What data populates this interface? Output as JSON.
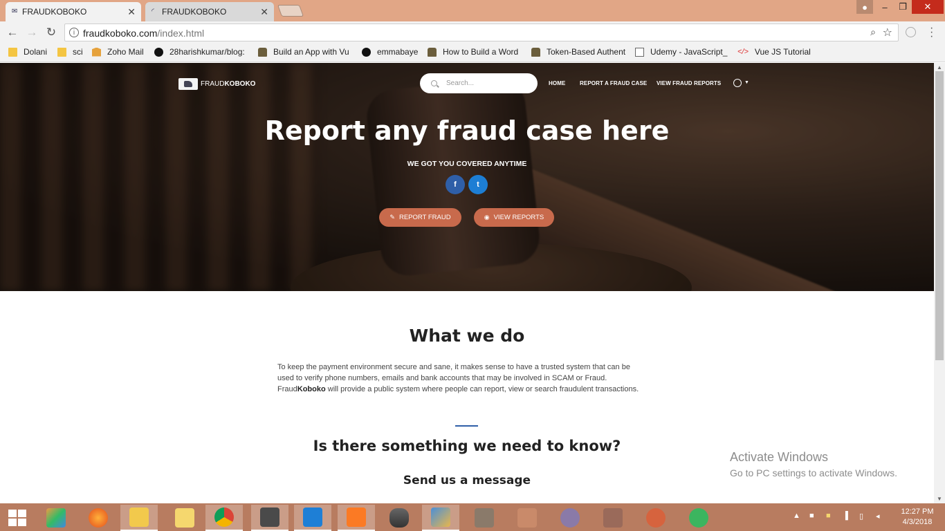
{
  "browser": {
    "tabs": [
      {
        "label": "FRAUDKOBOKO",
        "active": true
      },
      {
        "label": "FRAUDKOBOKO",
        "active": false
      }
    ],
    "url_host": "fraudkoboko.com",
    "url_path": "/index.html",
    "bookmarks": [
      {
        "label": "Dolani",
        "icon": "folder-icon"
      },
      {
        "label": "sci",
        "icon": "folder-icon"
      },
      {
        "label": "Zoho Mail",
        "icon": "mail-icon"
      },
      {
        "label": "28harishkumar/blog:",
        "icon": "github-icon"
      },
      {
        "label": "Build an App with Vu",
        "icon": "mug-icon"
      },
      {
        "label": "emmabaye",
        "icon": "github-icon"
      },
      {
        "label": "How to Build a Word",
        "icon": "mug-icon"
      },
      {
        "label": "Token-Based Authent",
        "icon": "mug-icon"
      },
      {
        "label": "Udemy - JavaScript_",
        "icon": "document-icon"
      },
      {
        "label": "Vue JS Tutorial",
        "icon": "code-icon"
      }
    ]
  },
  "site": {
    "logo_prefix": "FRAUD",
    "logo_bold": "KOBOKO",
    "search_placeholder": "Search...",
    "nav": [
      "HOME",
      "REPORT A FRAUD CASE",
      "VIEW FRAUD REPORTS"
    ],
    "hero_title": "Report any fraud case here",
    "hero_subtitle": "WE GOT YOU COVERED ANYTIME",
    "social": {
      "facebook": "f",
      "twitter": "t"
    },
    "btn_report": "REPORT FRAUD",
    "btn_view": "VIEW REPORTS",
    "what_title": "What we do",
    "about_text_1": "To keep the payment environment secure and sane, it makes sense to have a trusted system that can be used to verify phone numbers, emails and bank accounts that may be involved in SCAM or Fraud. Fraud",
    "about_bold": "Koboko",
    "about_text_2": " will provide a public system where people can report, view or search fraudulent transactions.",
    "know_title": "Is there something we need to know?",
    "message_title": "Send us a message"
  },
  "watermark": {
    "line1": "Activate Windows",
    "line2": "Go to PC settings to activate Windows."
  },
  "taskbar": {
    "apps": [
      "paint-icon",
      "firefox-icon",
      "file-explorer-icon",
      "sticky-notes-icon",
      "chrome-icon",
      "sublime-icon",
      "vscode-icon",
      "xampp-icon",
      "database-icon",
      "git-icon",
      "sublime-alt-icon",
      "xampp-alt-icon",
      "tor-icon",
      "git-gui-icon",
      "postman-icon",
      "whatsapp-icon"
    ],
    "time": "12:27 PM",
    "date": "4/3/2018"
  }
}
